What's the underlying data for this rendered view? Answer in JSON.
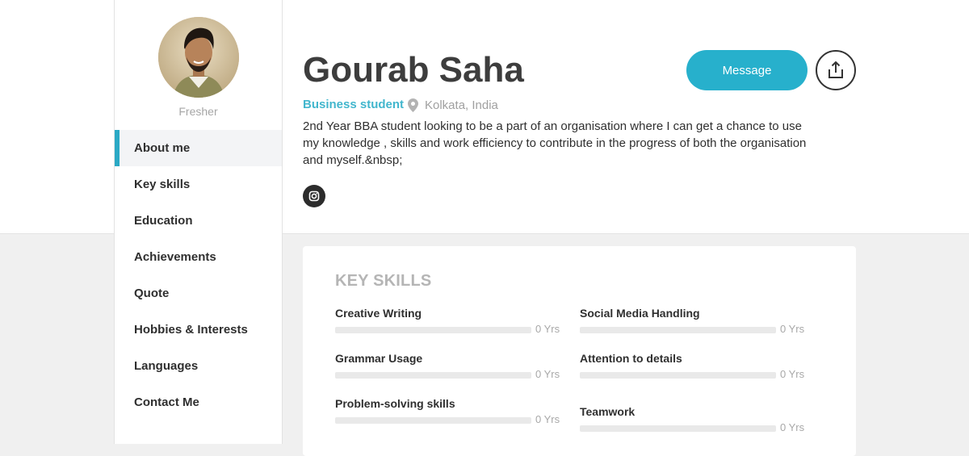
{
  "profile": {
    "name": "Gourab Saha",
    "role": "Business student",
    "location": "Kolkata, India",
    "status": "Fresher",
    "bio": "2nd Year BBA student looking to be a part of an organisation where I can get a chance to use my knowledge , skills and work efficiency to contribute in the progress of both the organisation and myself.&nbsp;",
    "social_icon": "instagram-icon"
  },
  "actions": {
    "message_label": "Message",
    "share_icon": "share-icon"
  },
  "sidebar": {
    "items": [
      {
        "label": "About me",
        "active": true
      },
      {
        "label": "Key skills",
        "active": false
      },
      {
        "label": "Education",
        "active": false
      },
      {
        "label": "Achievements",
        "active": false
      },
      {
        "label": "Quote",
        "active": false
      },
      {
        "label": "Hobbies & Interests",
        "active": false
      },
      {
        "label": "Languages",
        "active": false
      },
      {
        "label": "Contact Me",
        "active": false
      }
    ]
  },
  "key_skills": {
    "title": "KEY SKILLS",
    "items": [
      {
        "name": "Creative Writing",
        "years": "0 Yrs",
        "level": 0
      },
      {
        "name": "Social Media Handling",
        "years": "0 Yrs",
        "level": 0
      },
      {
        "name": "Grammar Usage",
        "years": "0 Yrs",
        "level": 0
      },
      {
        "name": "Attention to details",
        "years": "0 Yrs",
        "level": 0
      },
      {
        "name": "Problem-solving skills",
        "years": "0 Yrs",
        "level": 0
      },
      {
        "name": "Teamwork",
        "years": "0 Yrs",
        "level": 0
      }
    ]
  },
  "colors": {
    "accent": "#27b0cc",
    "role_text": "#42b6cd",
    "background": "#f0f0f0"
  }
}
